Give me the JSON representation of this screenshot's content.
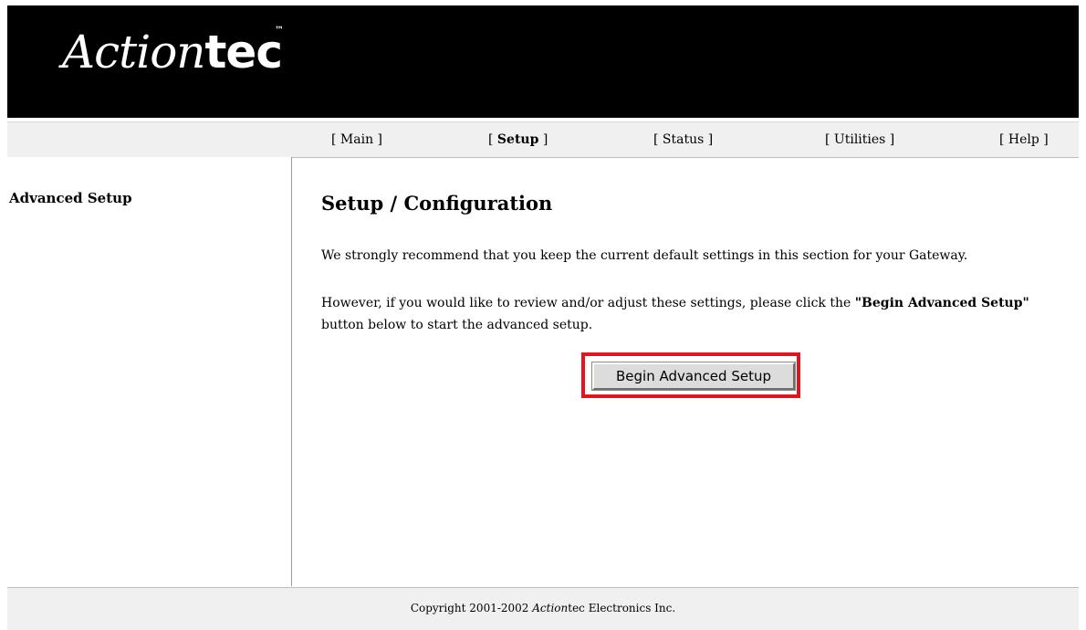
{
  "brand": {
    "logo_script": "Action",
    "logo_bold": "tec",
    "logo_tm": "™"
  },
  "nav": {
    "items": [
      {
        "open": "[ ",
        "label": "Main",
        "close": " ]"
      },
      {
        "open": "[ ",
        "label": "Setup",
        "close": " ]"
      },
      {
        "open": "[ ",
        "label": "Status",
        "close": " ]"
      },
      {
        "open": "[ ",
        "label": "Utilities",
        "close": " ]"
      },
      {
        "open": "[ ",
        "label": "Help",
        "close": " ]"
      }
    ]
  },
  "sidebar": {
    "title": "Advanced Setup"
  },
  "main": {
    "title": "Setup / Configuration",
    "para1": "We strongly recommend that you keep the current default settings in this section for your Gateway.",
    "para2_pre": "However, if you would like to review and/or adjust these settings, please click the ",
    "para2_bold": "\"Begin Advanced Setup\"",
    "para2_post": " button below to start the advanced setup.",
    "button_label": "Begin Advanced Setup"
  },
  "footer": {
    "pre": "Copyright 2001-2002 ",
    "brand_script": "Action",
    "brand_rest": "tec",
    "post": " Electronics Inc."
  },
  "colors": {
    "header_bg": "#000000",
    "nav_bg": "#f0f0f0",
    "highlight": "#e3141d"
  }
}
